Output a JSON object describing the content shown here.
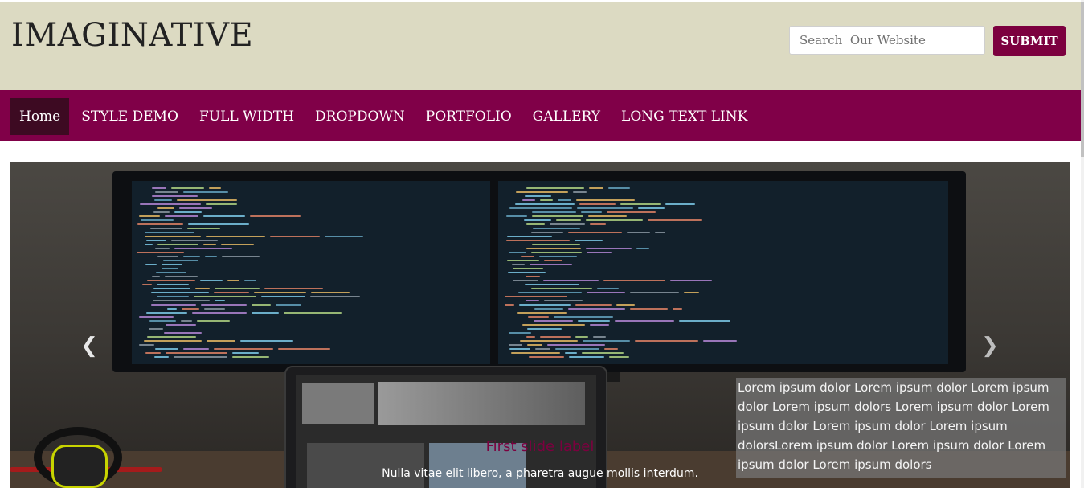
{
  "header": {
    "brand": "IMAGINATIVE",
    "search_placeholder": "Search  Our Website",
    "submit_label": "SUBMIT"
  },
  "nav": {
    "items": [
      {
        "label": "Home",
        "active": true
      },
      {
        "label": "STYLE DEMO",
        "active": false
      },
      {
        "label": "FULL WIDTH",
        "active": false
      },
      {
        "label": "DROPDOWN",
        "active": false
      },
      {
        "label": "PORTFOLIO",
        "active": false
      },
      {
        "label": "GALLERY",
        "active": false
      },
      {
        "label": "LONG TEXT LINK",
        "active": false
      }
    ]
  },
  "carousel": {
    "prev_icon": "chevron-left-icon",
    "next_icon": "chevron-right-icon",
    "caption_box": "Lorem ipsum dolor Lorem ipsum dolor Lorem ipsum dolor Lorem ipsum dolors Lorem ipsum dolor Lorem ipsum dolor Lorem ipsum dolor Lorem ipsum dolorsLorem ipsum dolor Lorem ipsum dolor Lorem ipsum dolor Lorem ipsum dolors",
    "slide_title": "First slide label",
    "slide_subtitle": "Nulla vitae elit libero, a pharetra augue mollis interdum."
  },
  "colors": {
    "header_bg": "#dcdac2",
    "accent": "#800048",
    "active_nav": "#3d0a22",
    "submit_bg": "#7c003f"
  }
}
